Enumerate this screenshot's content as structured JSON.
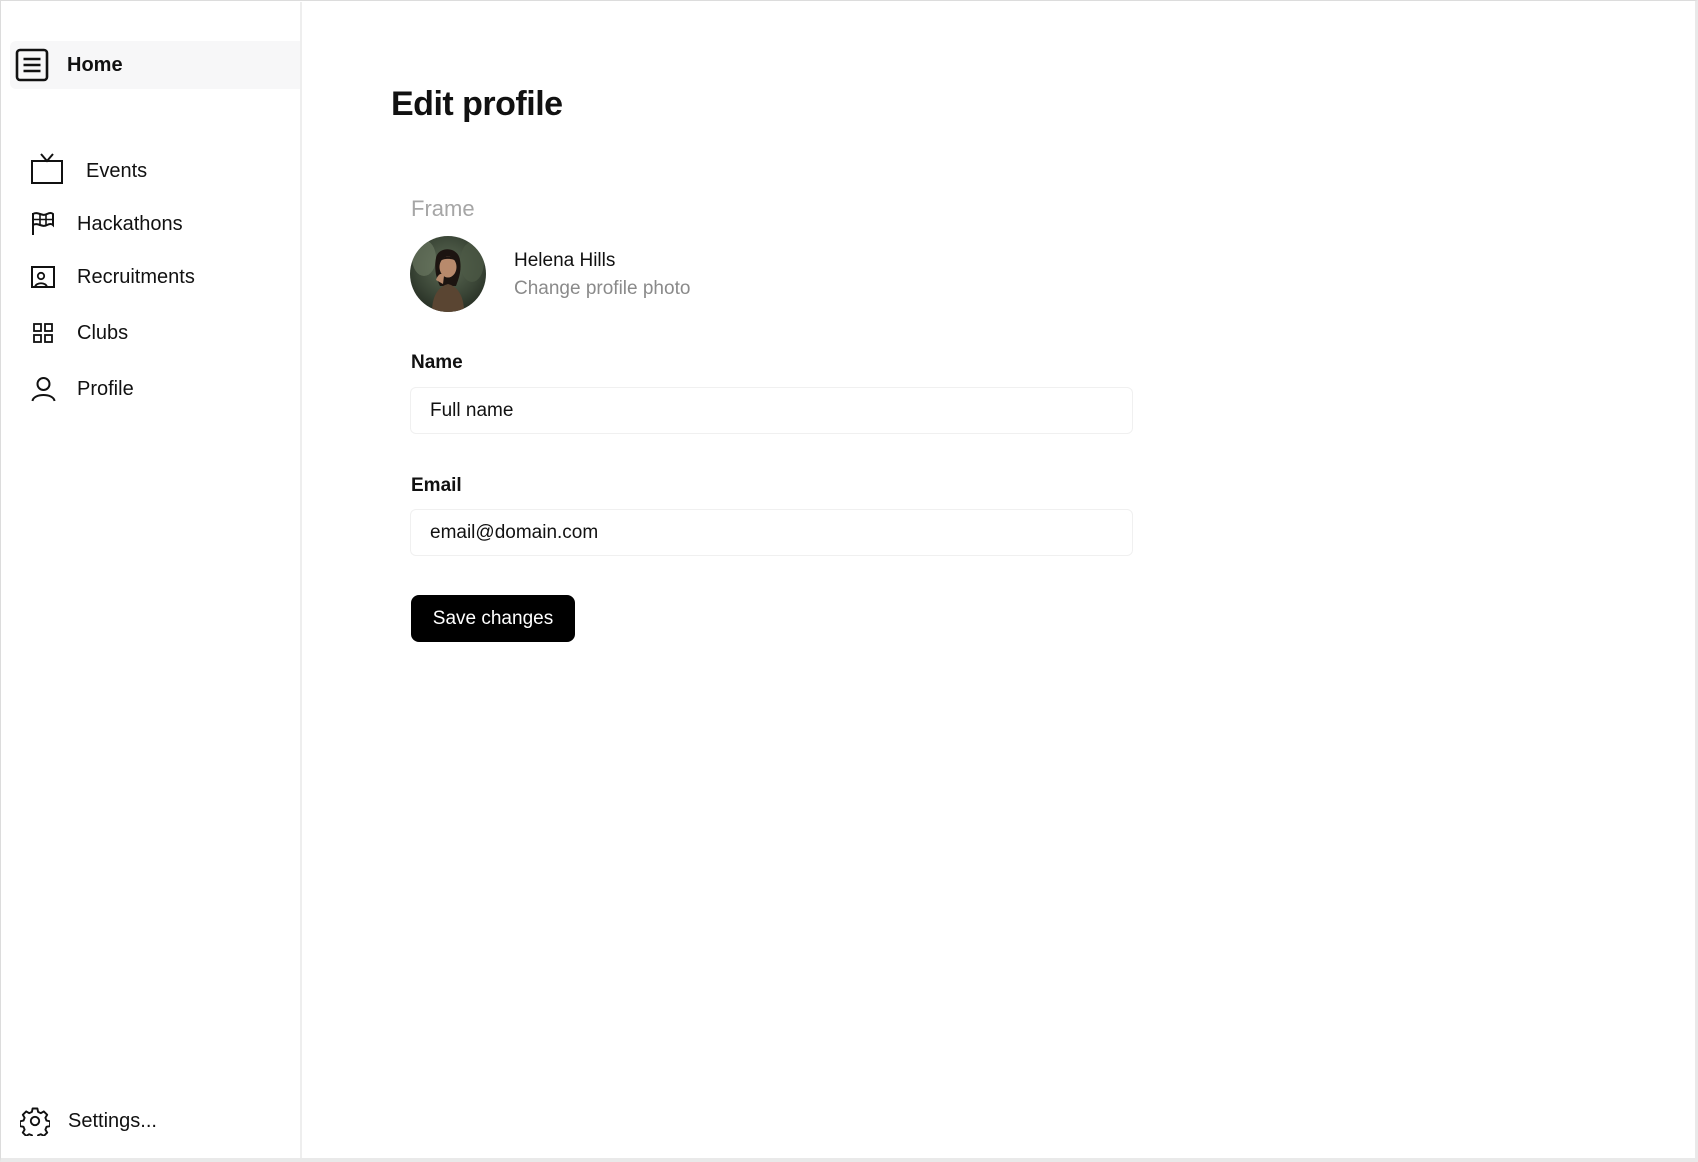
{
  "sidebar": {
    "home_label": "Home",
    "items": [
      {
        "label": "Events",
        "icon": "tv-icon"
      },
      {
        "label": "Hackathons",
        "icon": "flag-icon"
      },
      {
        "label": "Recruitments",
        "icon": "id-card-icon"
      },
      {
        "label": "Clubs",
        "icon": "grid-icon"
      },
      {
        "label": "Profile",
        "icon": "user-icon"
      }
    ],
    "settings_label": "Settings..."
  },
  "main": {
    "title": "Edit profile",
    "section_label": "Frame",
    "profile": {
      "name": "Helena Hills",
      "change_photo": "Change profile photo"
    },
    "form": {
      "name_label": "Name",
      "name_value": "Full name",
      "email_label": "Email",
      "email_value": "email@domain.com",
      "save_label": "Save changes"
    }
  },
  "colors": {
    "accent": "#000000",
    "muted_text": "#8a8a8a",
    "section_label": "#a6a6a6",
    "home_highlight": "#f7f7f8"
  }
}
